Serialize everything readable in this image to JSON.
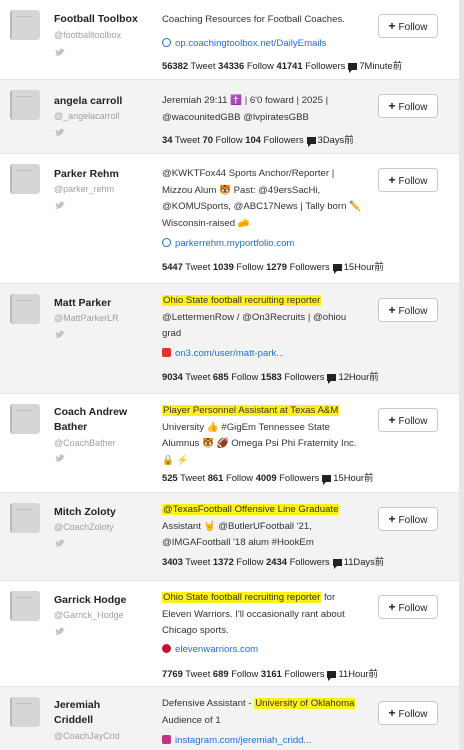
{
  "follow_label": "Follow",
  "rows": [
    {
      "name": "Football Toolbox",
      "handle": "@footballtoolbox",
      "bio_lines": [
        "Coaching Resources for Football Coaches."
      ],
      "link": "op.coachingtoolbox.net/DailyEmails",
      "tweets": "56382",
      "tweets_label": "Tweet",
      "follow_count": "34336",
      "follow_count_label": "Follow",
      "followers": "41741",
      "followers_label": "Followers",
      "time": "7Minute前"
    },
    {
      "name": "angela carroll",
      "handle": "@_angelacarroll",
      "bio_lines": [
        "Jeremiah 29:11 ✝️ | 6'0 foward | 2025 |",
        "@wacounitedGBB @lvpiratesGBB"
      ],
      "tweets": "34",
      "tweets_label": "Tweet",
      "follow_count": "70",
      "follow_count_label": "Follow",
      "followers": "104",
      "followers_label": "Followers",
      "time": "3Days前"
    },
    {
      "name": "Parker Rehm",
      "handle": "@parker_rehm",
      "bio_lines": [
        "@KWKTFox44 Sports Anchor/Reporter |",
        "Mizzou Alum 🐯 Past: @49ersSacHi,",
        "@KOMUSports, @ABC17News | Tally born ✏️",
        "Wisconsin-raised 🧀"
      ],
      "link": "parkerrehm.myportfolio.com",
      "tweets": "5447",
      "tweets_label": "Tweet",
      "follow_count": "1039",
      "follow_count_label": "Follow",
      "followers": "1279",
      "followers_label": "Followers",
      "time": "15Hour前"
    },
    {
      "name": "Matt Parker",
      "handle": "@MattParkerLR",
      "bio_highlight": "Ohio State football recruiting reporter",
      "bio_lines": [
        "@LettermenRow / @On3Recruits | @ohiou",
        "grad"
      ],
      "link": "on3.com/user/matt-park...",
      "tweets": "9034",
      "tweets_label": "Tweet",
      "follow_count": "685",
      "follow_count_label": "Follow",
      "followers": "1583",
      "followers_label": "Followers",
      "time": "12Hour前"
    },
    {
      "name": "Coach Andrew Bather",
      "handle": "@CoachBather",
      "bio_highlight": "Player Personnel Assistant at Texas A&M",
      "bio_lines": [
        "University 👍 #GigEm Tennessee State",
        "Alumnus 🐯 🏈 Omega Psi Phi Fraternity Inc.",
        "🔒 ⚡"
      ],
      "tweets": "525",
      "tweets_label": "Tweet",
      "follow_count": "861",
      "follow_count_label": "Follow",
      "followers": "4009",
      "followers_label": "Followers",
      "time": "15Hour前"
    },
    {
      "name": "Mitch Zoloty",
      "handle": "@CoachZoloty",
      "bio_highlight": "@TexasFootball Offensive Line Graduate",
      "bio_lines": [
        "Assistant 🤘 @ButlerUFootball '21,",
        "@IMGAFootball '18 alum #HookEm"
      ],
      "tweets": "3403",
      "tweets_label": "Tweet",
      "follow_count": "1372",
      "follow_count_label": "Follow",
      "followers": "2434",
      "followers_label": "Followers",
      "time": "11Days前"
    },
    {
      "name": "Garrick Hodge",
      "handle": "@Garrick_Hodge",
      "bio_highlight": "Ohio State football recruiting reporter",
      "bio_highlight_tail": " for",
      "bio_lines": [
        "Eleven Warriors. I'll occasionally rant about",
        "Chicago sports."
      ],
      "link": "elevenwarriors.com",
      "tweets": "7769",
      "tweets_label": "Tweet",
      "follow_count": "689",
      "follow_count_label": "Follow",
      "followers": "3161",
      "followers_label": "Followers",
      "time": "11Hour前"
    },
    {
      "name": "Jeremiah Criddell",
      "handle": "@CoachJayCrid",
      "bio_prefix": "Defensive Assistant - ",
      "bio_highlight": "University of Oklahoma",
      "bio_lines": [
        "Audience of 1"
      ],
      "link": "instagram.com/jeremiah_cridd..."
    }
  ]
}
